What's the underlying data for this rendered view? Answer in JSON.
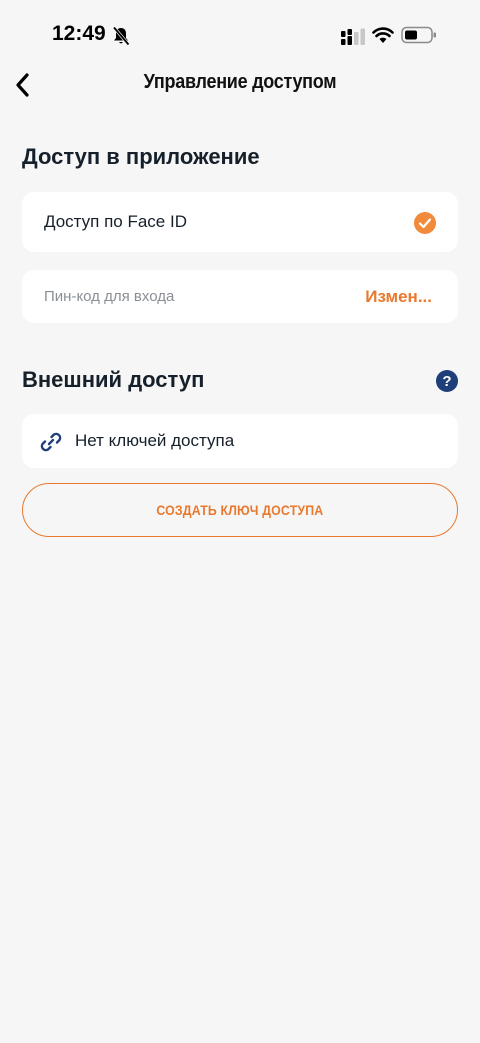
{
  "status_bar": {
    "time": "12:49",
    "icons": [
      "bell-off-icon",
      "signal-icon",
      "wifi-icon",
      "battery-icon"
    ]
  },
  "header": {
    "title": "Управление доступом",
    "back_icon": "chevron-left-icon"
  },
  "app_access": {
    "section_title": "Доступ в приложение",
    "face_id_label": "Доступ по Face ID",
    "face_id_enabled": true,
    "pin_label": "Пин-код для входа",
    "pin_action": "Измен..."
  },
  "external_access": {
    "section_title": "Внешний доступ",
    "help_icon_text": "?",
    "empty_label": "Нет ключей доступа",
    "create_button": "СОЗДАТЬ КЛЮЧ ДОСТУПА"
  },
  "colors": {
    "accent": "#e8792e",
    "check": "#f28a3c",
    "help": "#1f3f7a",
    "background": "#f6f6f6",
    "card": "#ffffff",
    "text": "#15202b"
  }
}
